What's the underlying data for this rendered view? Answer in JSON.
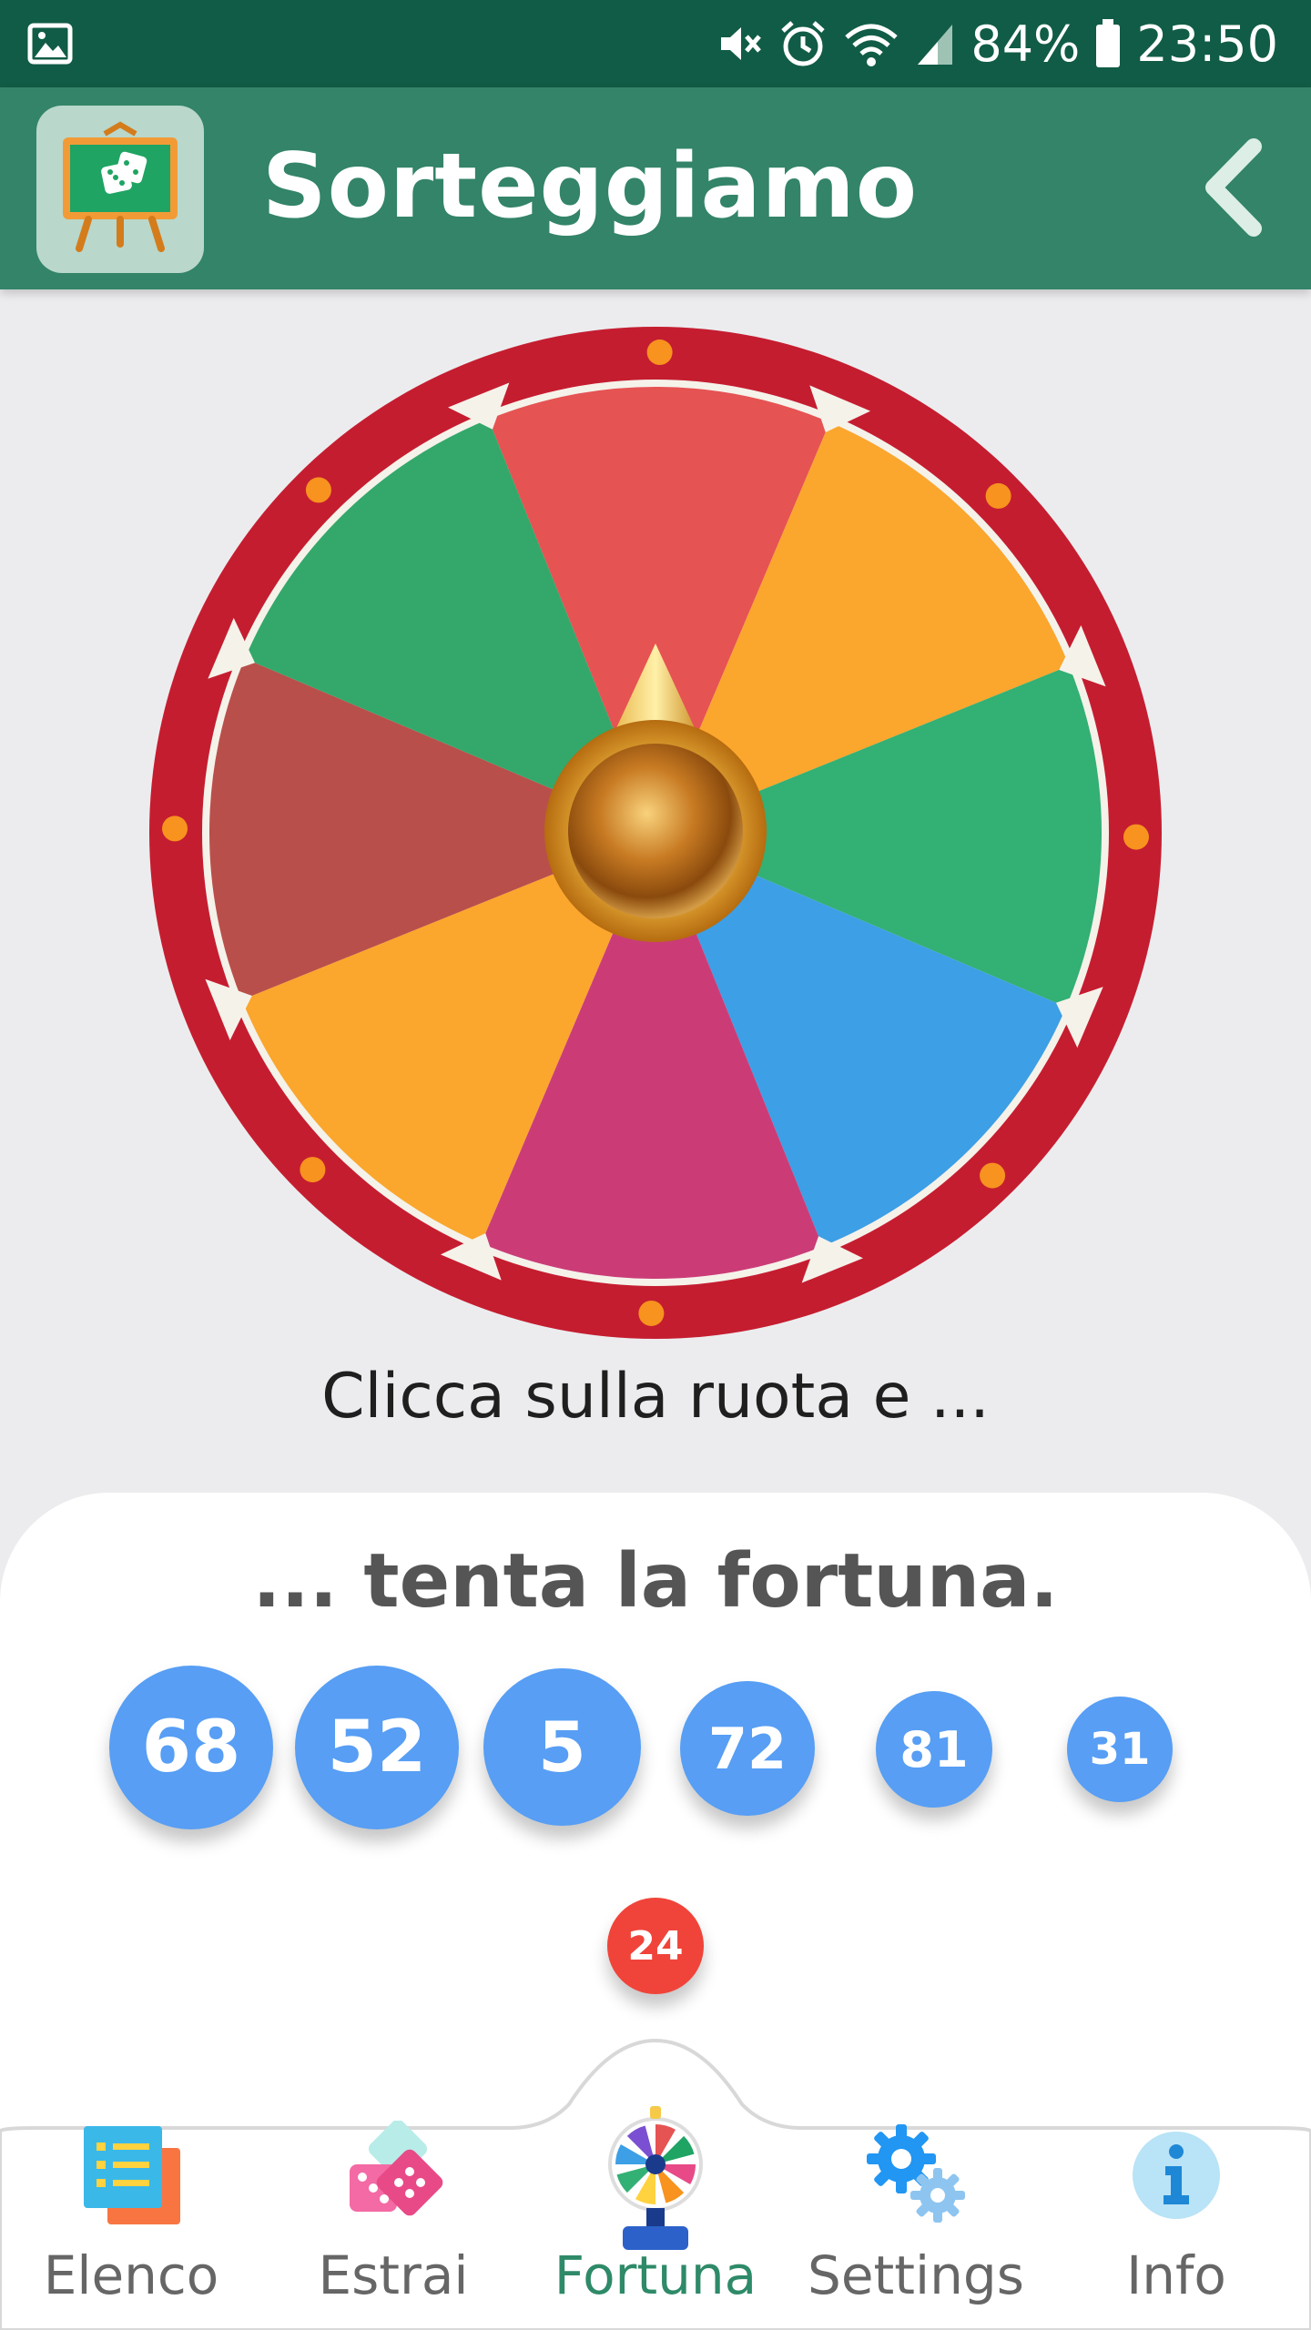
{
  "status_bar": {
    "battery": "84%",
    "time": "23:50",
    "icons": [
      "image-icon",
      "mute-icon",
      "alarm-icon",
      "wifi-icon",
      "signal-icon",
      "battery-icon"
    ]
  },
  "app_bar": {
    "title": "Sorteggiamo",
    "logo_icon": "dice-board-icon",
    "back_icon": "chevron-left-icon"
  },
  "wheel": {
    "segment_colors": [
      "#e65353",
      "#fba62d",
      "#33b074",
      "#3d9fe6",
      "#cb3c77",
      "#fba62d",
      "#b94f4b",
      "#33a86a"
    ],
    "rim_color": "#c51d30",
    "bulb_color": "#f7931e"
  },
  "hint": "Clicca sulla ruota e ...",
  "sheet": {
    "title": "... tenta la fortuna.",
    "balls": [
      "68",
      "52",
      "5",
      "72",
      "81",
      "31"
    ],
    "last": "24"
  },
  "nav": {
    "items": [
      {
        "label": "Elenco",
        "icon": "list-icon"
      },
      {
        "label": "Estrai",
        "icon": "dice-icon"
      },
      {
        "label": "Fortuna",
        "icon": "wheel-icon"
      },
      {
        "label": "Settings",
        "icon": "gears-icon"
      },
      {
        "label": "Info",
        "icon": "info-icon"
      }
    ],
    "active": "Fortuna",
    "active_color": "#2e8a68"
  }
}
